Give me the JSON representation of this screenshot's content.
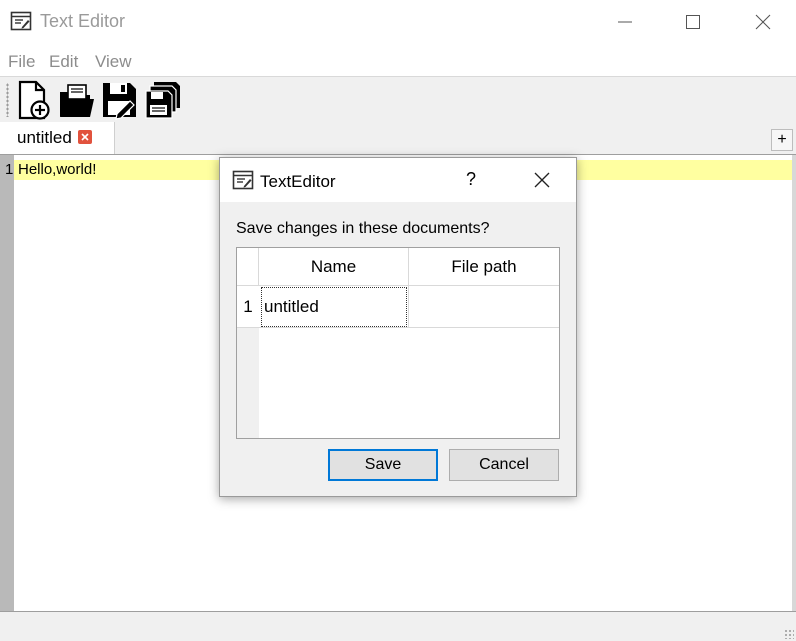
{
  "window": {
    "title": "Text Editor"
  },
  "menu": {
    "file": "File",
    "edit": "Edit",
    "view": "View"
  },
  "toolbar": {
    "icons": [
      "new-document-icon",
      "open-folder-icon",
      "save-icon",
      "save-all-icon"
    ]
  },
  "tabs": [
    {
      "label": "untitled",
      "has_close": true
    }
  ],
  "tabbar": {
    "add_label": "+"
  },
  "editor": {
    "lines": [
      {
        "number": "1",
        "text": "Hello,world!"
      }
    ],
    "current_line_color": "#ffffa0"
  },
  "dialog": {
    "title": "TextEditor",
    "help_label": "?",
    "message": "Save changes in these documents?",
    "table": {
      "columns": [
        "Name",
        "File path"
      ],
      "rows": [
        {
          "number": "1",
          "name": "untitled",
          "path": ""
        }
      ]
    },
    "save_label": "Save",
    "cancel_label": "Cancel",
    "accent_color": "#0078d7"
  }
}
